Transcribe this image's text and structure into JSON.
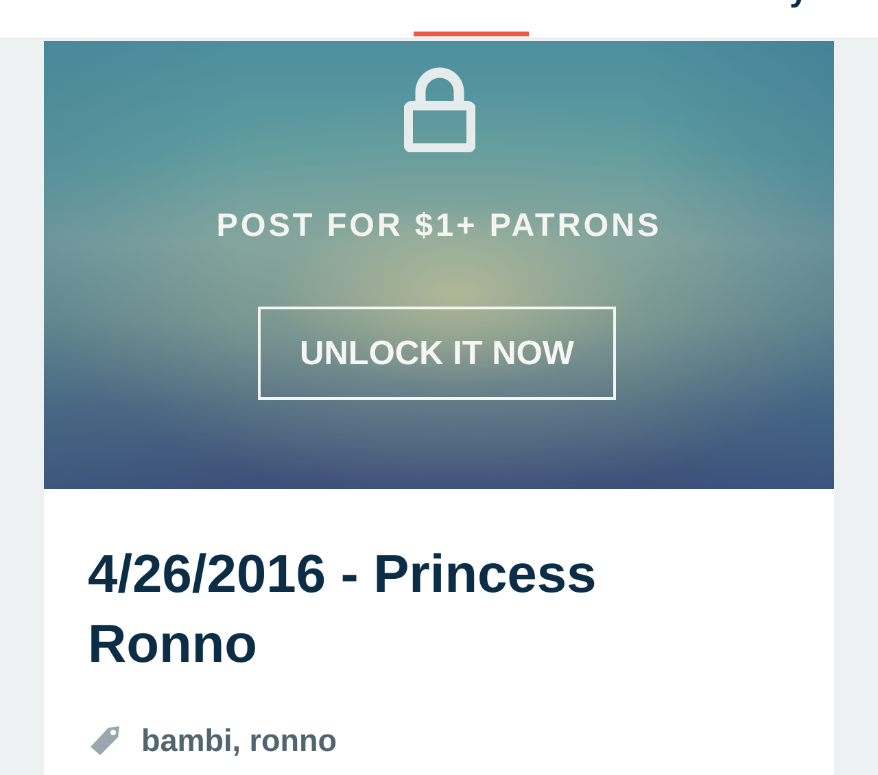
{
  "colors": {
    "accent": "#f0574a",
    "title_text": "#0b2e46",
    "tag_text": "#52656f",
    "banner_text": "#f4f4f0"
  },
  "post": {
    "lock_icon": "lock-icon",
    "tier_label": "POST FOR $1+ PATRONS",
    "unlock_button_label": "UNLOCK IT NOW",
    "title": "4/26/2016 - Princess Ronno",
    "tag_icon": "tag-icon",
    "tags": "bambi, ronno"
  }
}
